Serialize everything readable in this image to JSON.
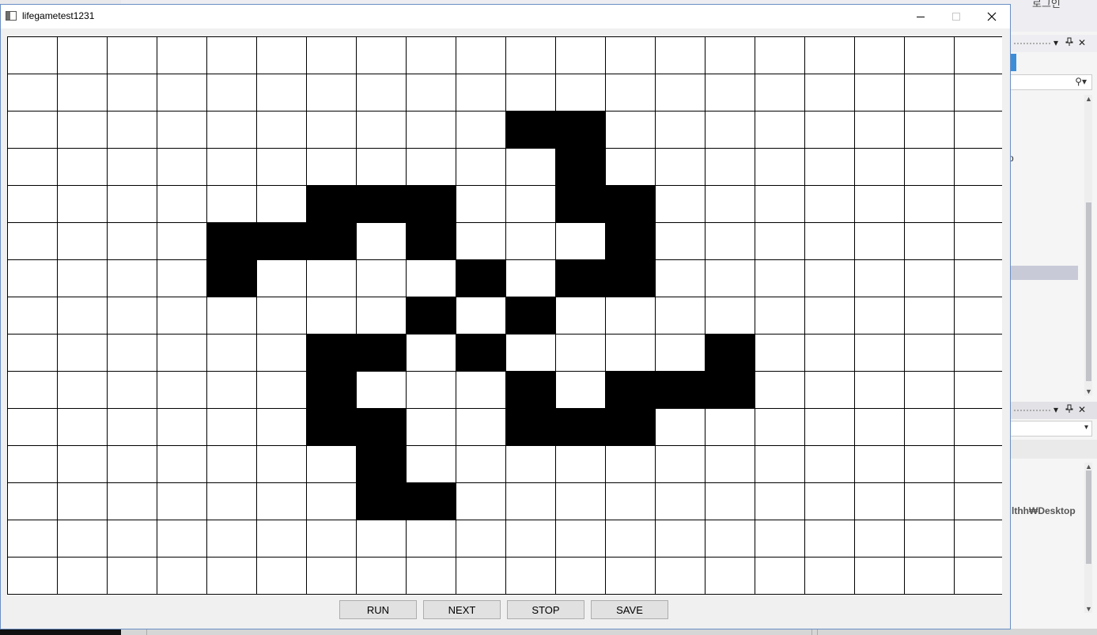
{
  "window": {
    "title": "lifegametest1231",
    "minimize_icon": "minimize-icon",
    "maximize_icon": "maximize-icon",
    "close_icon": "close-icon"
  },
  "grid": {
    "columns": 20,
    "rows": 15,
    "cell_color_alive": "#000000",
    "cell_color_dead": "#ffffff",
    "line_color": "#000000",
    "alive_cells": [
      [
        2,
        10
      ],
      [
        2,
        11
      ],
      [
        3,
        11
      ],
      [
        4,
        6
      ],
      [
        4,
        7
      ],
      [
        4,
        8
      ],
      [
        4,
        11
      ],
      [
        4,
        12
      ],
      [
        5,
        4
      ],
      [
        5,
        5
      ],
      [
        5,
        6
      ],
      [
        5,
        8
      ],
      [
        5,
        12
      ],
      [
        6,
        4
      ],
      [
        6,
        9
      ],
      [
        6,
        11
      ],
      [
        6,
        12
      ],
      [
        7,
        8
      ],
      [
        7,
        10
      ],
      [
        8,
        6
      ],
      [
        8,
        7
      ],
      [
        8,
        9
      ],
      [
        8,
        14
      ],
      [
        9,
        6
      ],
      [
        9,
        10
      ],
      [
        9,
        12
      ],
      [
        9,
        13
      ],
      [
        9,
        14
      ],
      [
        10,
        6
      ],
      [
        10,
        7
      ],
      [
        10,
        10
      ],
      [
        10,
        11
      ],
      [
        10,
        12
      ],
      [
        11,
        7
      ],
      [
        12,
        7
      ],
      [
        12,
        8
      ]
    ]
  },
  "controls": {
    "run_label": "RUN",
    "next_label": "NEXT",
    "stop_label": "STOP",
    "save_label": "SAVE"
  },
  "background_ide": {
    "login_text": "로그인",
    "path_fragment": "lthh₩Desktop",
    "text_fragment": "p",
    "accent_color": "#3c8dd7"
  }
}
